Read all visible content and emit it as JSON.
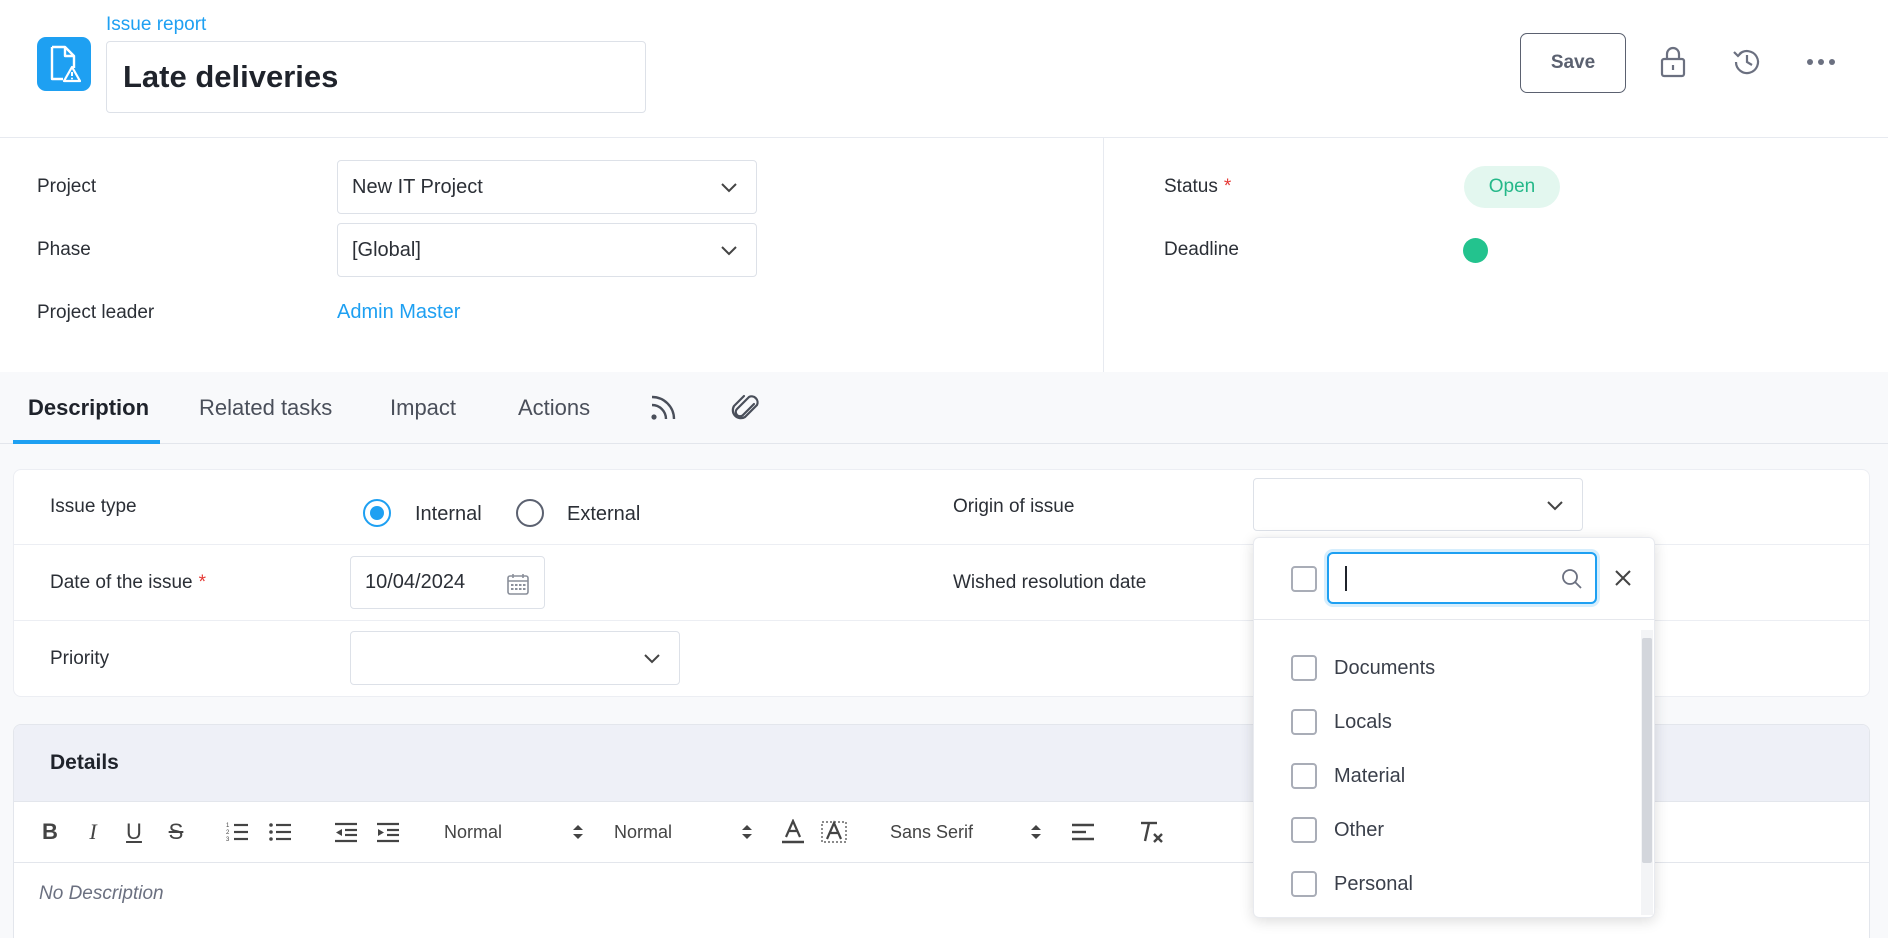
{
  "header": {
    "doc_type": "Issue report",
    "title": "Late deliveries",
    "save_label": "Save"
  },
  "info": {
    "project_label": "Project",
    "project_value": "New IT Project",
    "phase_label": "Phase",
    "phase_value": "[Global]",
    "leader_label": "Project leader",
    "leader_value": "Admin Master",
    "status_label": "Status",
    "status_value": "Open",
    "deadline_label": "Deadline",
    "required_mark": "*"
  },
  "tabs": [
    {
      "label": "Description"
    },
    {
      "label": "Related tasks"
    },
    {
      "label": "Impact"
    },
    {
      "label": "Actions"
    }
  ],
  "form": {
    "issue_type_label": "Issue type",
    "internal_label": "Internal",
    "external_label": "External",
    "issue_type_selected": "Internal",
    "origin_label": "Origin of issue",
    "date_label": "Date of the issue",
    "date_value": "10/04/2024",
    "wished_label": "Wished resolution date",
    "priority_label": "Priority"
  },
  "details": {
    "title": "Details",
    "size_select": "Normal",
    "heading_select": "Normal",
    "font_select": "Sans Serif",
    "placeholder": "No Description"
  },
  "origin_dropdown": {
    "search_value": "",
    "options": [
      "Documents",
      "Locals",
      "Material",
      "Other",
      "Personal"
    ]
  },
  "colors": {
    "accent": "#1ea0f2",
    "status_green": "#25b889",
    "deadline_dot": "#23c38e",
    "required": "#e53935"
  },
  "icons": {
    "app": "document-warning-icon",
    "lock": "lock-icon",
    "history": "history-icon",
    "more": "more-horizontal-icon",
    "rss": "rss-feed-icon",
    "attachment": "paperclip-icon"
  }
}
